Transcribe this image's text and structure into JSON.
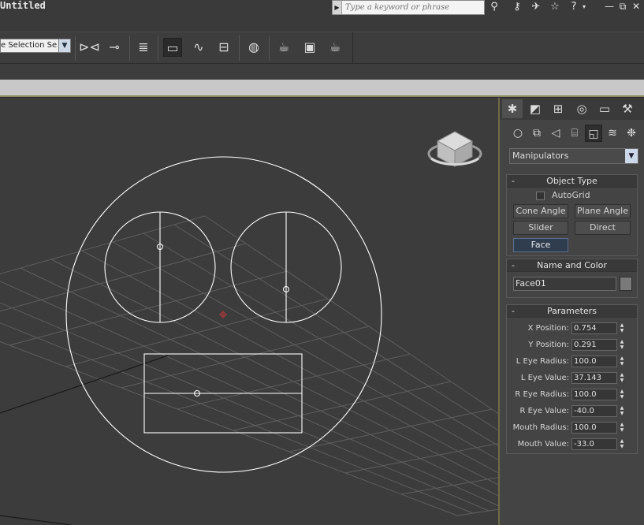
{
  "title": "Untitled",
  "search": {
    "placeholder": "Type a keyword or phrase"
  },
  "title_icons": [
    "binoculars-icon",
    "key-icon",
    "satellite-icon",
    "star-icon",
    "help-icon"
  ],
  "window_buttons": {
    "minimize": "—",
    "restore": "⧉",
    "close": "✕"
  },
  "toolbar": {
    "selection_set": "Create Selection Set",
    "selection_set_visible": "e Selection Se"
  },
  "panel": {
    "tabs": [
      "create",
      "modify",
      "hierarchy",
      "motion",
      "display",
      "utilities"
    ],
    "categories": [
      "geometry",
      "shapes",
      "lights",
      "cameras",
      "helpers",
      "space-warps",
      "systems"
    ],
    "category_dropdown": "Manipulators",
    "object_type": {
      "title": "Object Type",
      "autogrid_label": "AutoGrid",
      "buttons": [
        "Cone Angle",
        "Plane Angle",
        "Slider",
        "Direct",
        "Face"
      ],
      "active_button": "Face"
    },
    "name_and_color": {
      "title": "Name and Color",
      "name": "Face01",
      "color": "#7a7a7a"
    },
    "parameters": {
      "title": "Parameters",
      "rows": [
        {
          "label": "X Position:",
          "value": "0.754"
        },
        {
          "label": "Y Position:",
          "value": "0.291"
        },
        {
          "label": "L Eye Radius:",
          "value": "100.0"
        },
        {
          "label": "L Eye Value:",
          "value": "37.143"
        },
        {
          "label": "R Eye Radius:",
          "value": "100.0"
        },
        {
          "label": "R Eye Value:",
          "value": "-40.0"
        },
        {
          "label": "Mouth Radius:",
          "value": "100.0"
        },
        {
          "label": "Mouth Value:",
          "value": "-33.0"
        }
      ]
    }
  },
  "colors": {
    "viewport_bg": "#3c3c3c",
    "grid": "#5e5e5e",
    "face_lines": "#ffffff",
    "pivot": "#a33a3a",
    "active_button": "#2f3d4f"
  }
}
